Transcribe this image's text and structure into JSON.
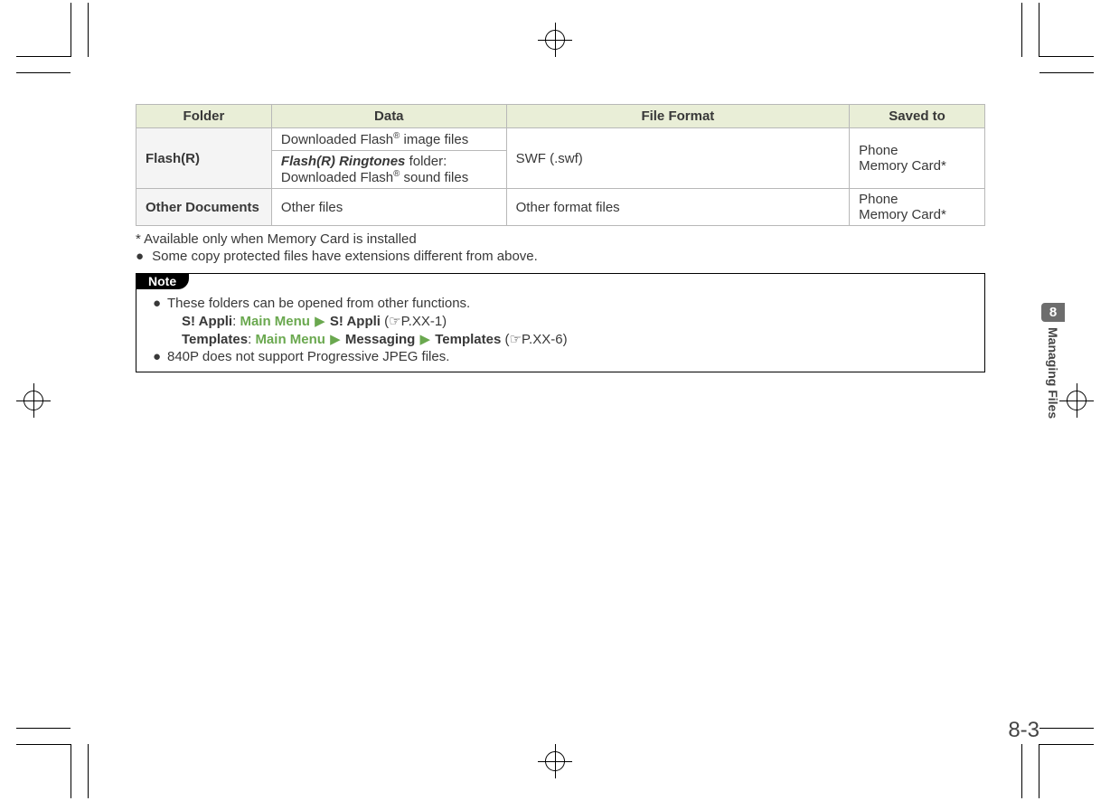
{
  "table": {
    "headers": {
      "folder": "Folder",
      "data": "Data",
      "format": "File Format",
      "saved": "Saved to"
    },
    "rows": {
      "flash": {
        "folder": "Flash(R)",
        "data1_pre": "Downloaded Flash",
        "data1_post": " image files",
        "data2_boldpre": "Flash(R) Ringtones",
        "data2_mid": " folder:",
        "data2_line2pre": "Downloaded Flash",
        "data2_line2post": " sound files",
        "format": "SWF (.swf)",
        "saved1": "Phone",
        "saved2": "Memory Card*"
      },
      "other": {
        "folder": "Other Documents",
        "data": "Other files",
        "format": "Other format files",
        "saved1": "Phone",
        "saved2": "Memory Card*"
      }
    }
  },
  "footnotes": {
    "f1": "* Available only when Memory Card is installed",
    "f2": "Some copy protected files have extensions different from above."
  },
  "note": {
    "label": "Note",
    "b1": "These folders can be opened from other functions.",
    "s1a": "S! Appli",
    "s1b": "Main Menu",
    "s1c": "S! Appli",
    "s1ref": "P.XX-1",
    "s2a": "Templates",
    "s2b": "Main Menu",
    "s2c": "Messaging",
    "s2d": "Templates",
    "s2ref": "P.XX-6",
    "b2": "840P does not support Progressive JPEG files."
  },
  "side": {
    "num": "8",
    "title": "Managing Files"
  },
  "pagenum": "8-3",
  "sym": {
    "arrow": "▶",
    "bullet": "●",
    "hand": "☞",
    "reg": "®",
    "colon": ": "
  }
}
